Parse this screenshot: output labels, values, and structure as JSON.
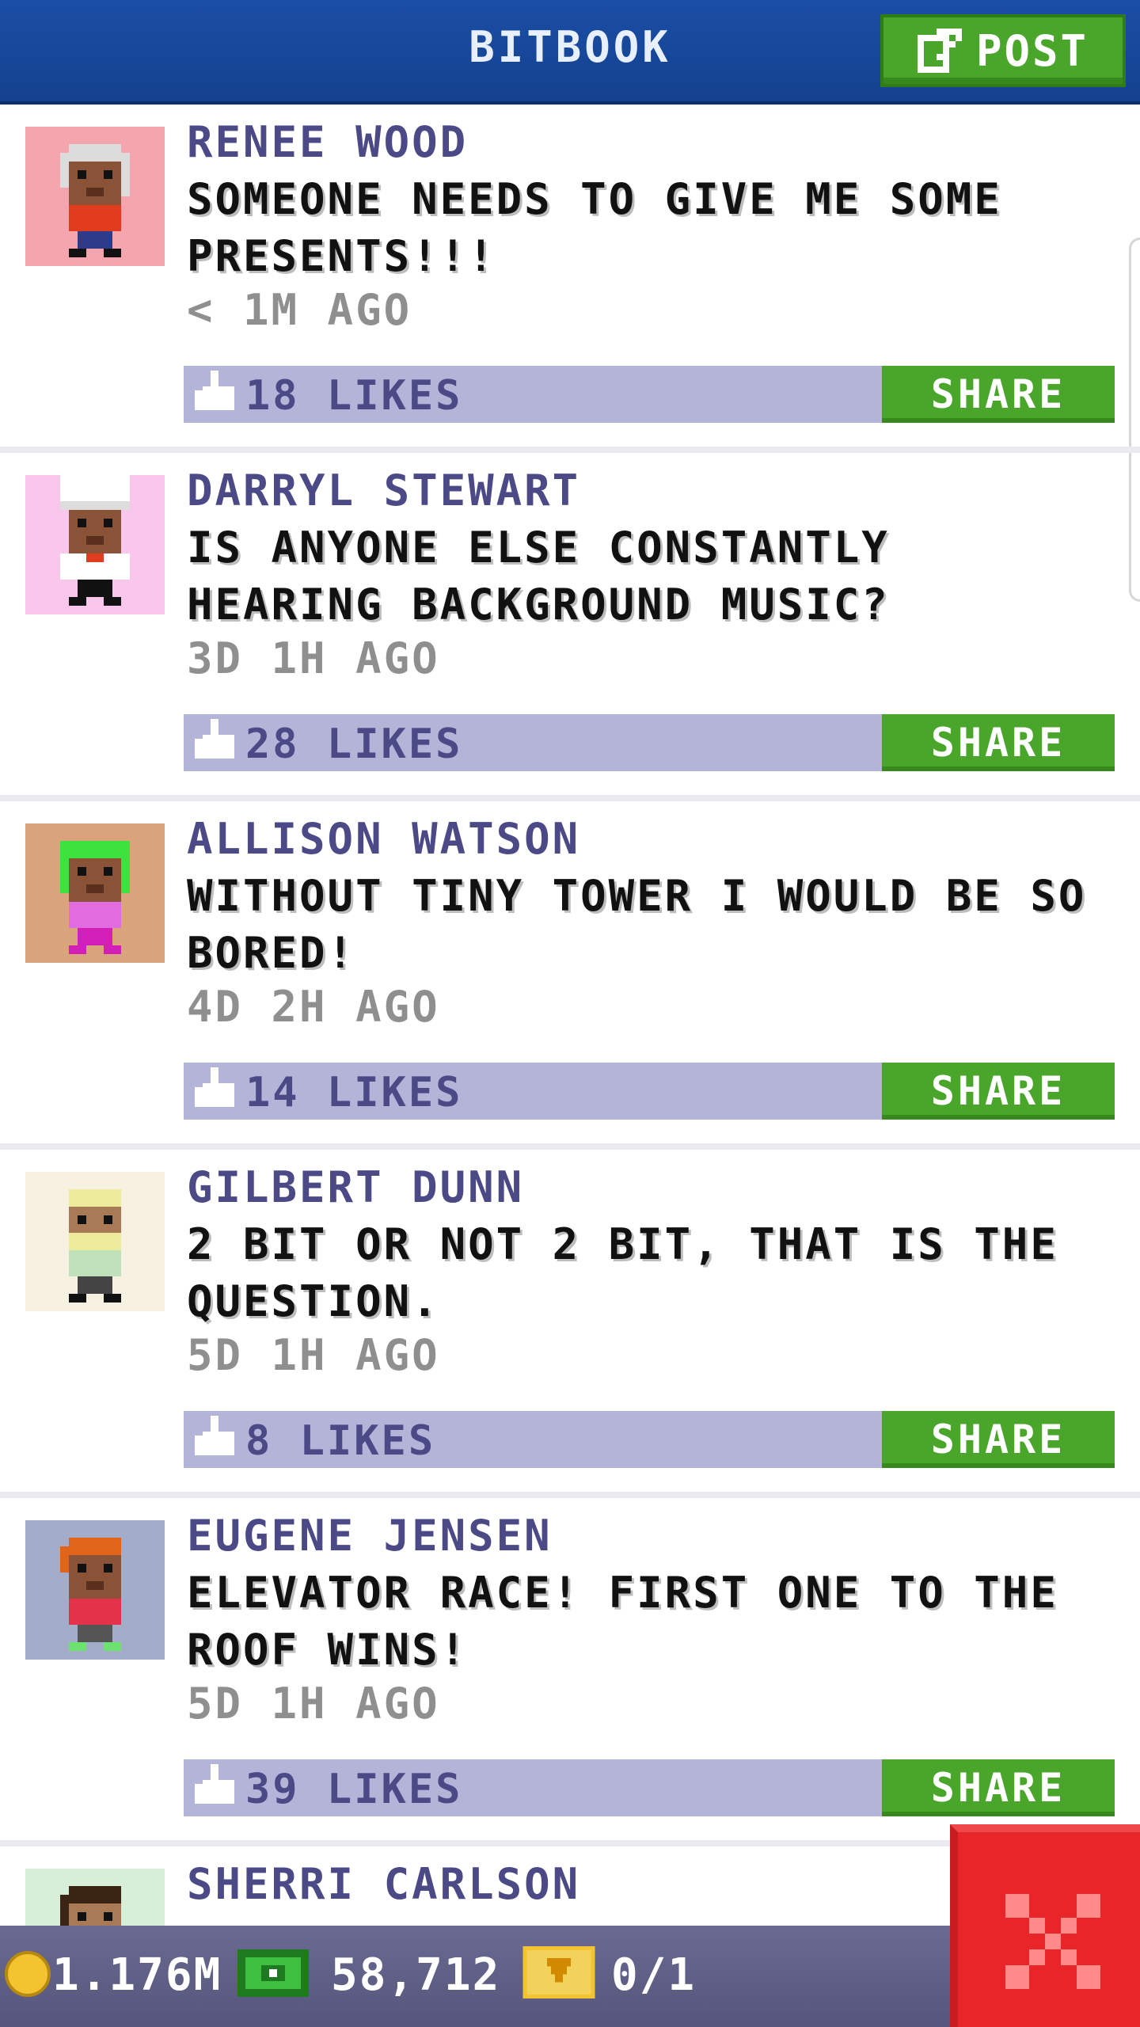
{
  "header": {
    "title": "BITBOOK",
    "post_label": "POST",
    "post_icon": "edit-icon",
    "background": "#1a4ea5"
  },
  "posts": [
    {
      "name": "RENEE WOOD",
      "message": "SOMEONE NEEDS TO GIVE ME SOME PRESENTS!!!",
      "time": "< 1M AGO",
      "likes": "18 LIKES",
      "share_label": "SHARE",
      "avatar": {
        "bg": "#f4a5ad",
        "skin": "#8a5236",
        "hair": "#dcdcdc",
        "shirt": "#e23c1f",
        "pants": "#2e3b8a",
        "hat": "none"
      }
    },
    {
      "name": "DARRYL STEWART",
      "message": "IS ANYONE ELSE CONSTANTLY HEARING BACKGROUND MUSIC?",
      "time": "3D 1H AGO",
      "likes": "28 LIKES",
      "share_label": "SHARE",
      "avatar": {
        "bg": "#f9c6ec",
        "skin": "#8a5236",
        "hair": "#ffffff",
        "shirt": "#ffffff",
        "pants": "#111111",
        "hat": "chef"
      }
    },
    {
      "name": "ALLISON WATSON",
      "message": "WITHOUT TINY TOWER I WOULD BE SO BORED!",
      "time": "4D 2H AGO",
      "likes": "14 LIKES",
      "share_label": "SHARE",
      "avatar": {
        "bg": "#d9a47c",
        "skin": "#8a5236",
        "hair": "#3ee23e",
        "shirt": "#e06ce0",
        "pants": "#d11fb8",
        "hat": "none"
      }
    },
    {
      "name": "GILBERT DUNN",
      "message": "2 BIT OR NOT 2 BIT, THAT IS THE QUESTION.",
      "time": "5D 1H AGO",
      "likes": "8 LIKES",
      "share_label": "SHARE",
      "avatar": {
        "bg": "#f7f1e1",
        "skin": "#a87a55",
        "hair": "#ecec9a",
        "shirt": "#bfe0b8",
        "pants": "#444444",
        "hat": "none"
      }
    },
    {
      "name": "EUGENE JENSEN",
      "message": "ELEVATOR RACE! FIRST ONE TO THE ROOF WINS!",
      "time": "5D 1H AGO",
      "likes": "39 LIKES",
      "share_label": "SHARE",
      "avatar": {
        "bg": "#a3adc9",
        "skin": "#8a5236",
        "hair": "#e0641a",
        "shirt": "#e4324a",
        "pants": "#6ee26e",
        "hat": "none"
      }
    }
  ],
  "partial_post": {
    "name": "SHERRI CARLSON",
    "avatar": {
      "bg": "#d7efd9",
      "skin": "#a87a55",
      "hair": "#3a2414"
    }
  },
  "bottom_bar": {
    "coins": "1.176M",
    "coins_icon": "coin-icon",
    "bux": "58,712",
    "bux_icon": "cash-icon",
    "tickets": "0/1",
    "tickets_icon": "ticket-icon"
  },
  "close_icon": "close-icon"
}
